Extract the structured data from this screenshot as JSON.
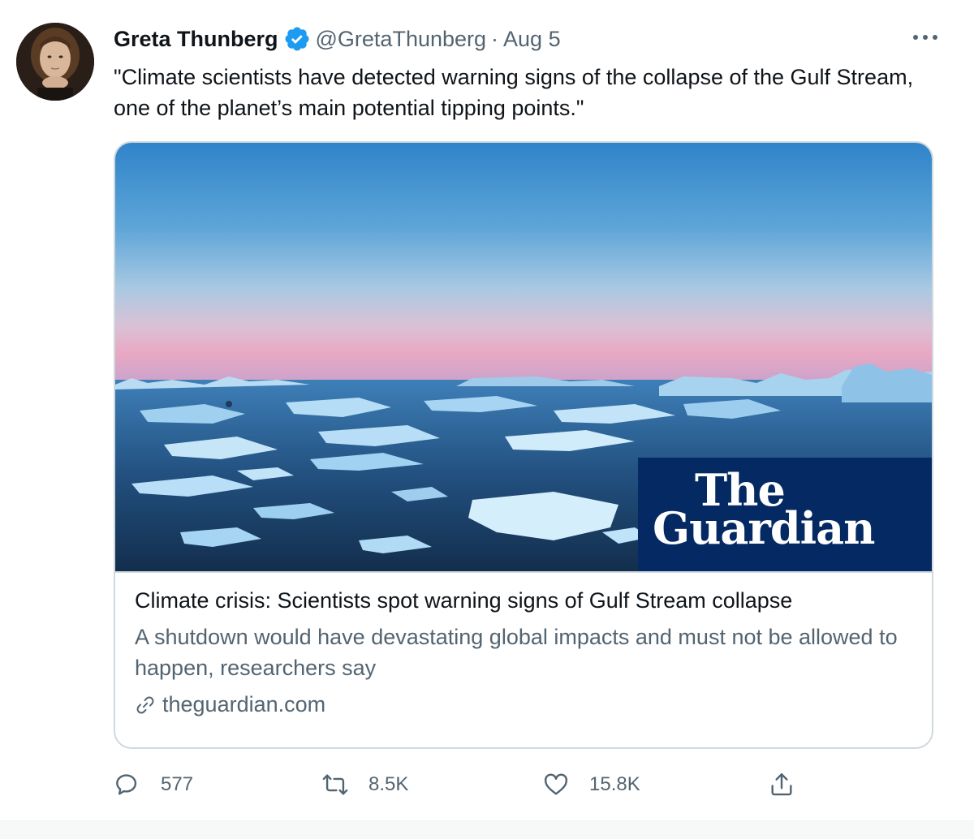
{
  "tweet": {
    "author_name": "Greta Thunberg",
    "handle": "@GretaThunberg",
    "separator": "·",
    "date": "Aug 5",
    "verified": true,
    "text": "\"Climate scientists have detected warning signs of the collapse of the Gulf Stream, one of the planet’s main potential tipping points.\""
  },
  "card": {
    "logo_line1": "The",
    "logo_line2": "Guardian",
    "title": "Climate crisis: Scientists spot warning signs of Gulf Stream collapse",
    "description": "A shutdown would have devastating global impacts and must not be allowed to happen, researchers say",
    "domain": "theguardian.com"
  },
  "actions": {
    "replies": "577",
    "retweets": "8.5K",
    "likes": "15.8K"
  },
  "icons": {
    "verified": "verified-badge-icon",
    "more": "more-horizontal-icon",
    "link": "link-icon",
    "reply": "reply-icon",
    "retweet": "retweet-icon",
    "like": "heart-icon",
    "share": "share-icon"
  },
  "colors": {
    "verified": "#1d9bf0",
    "secondary_text": "#536471",
    "card_border": "#cfd9de",
    "guardian_blue": "#052962"
  }
}
